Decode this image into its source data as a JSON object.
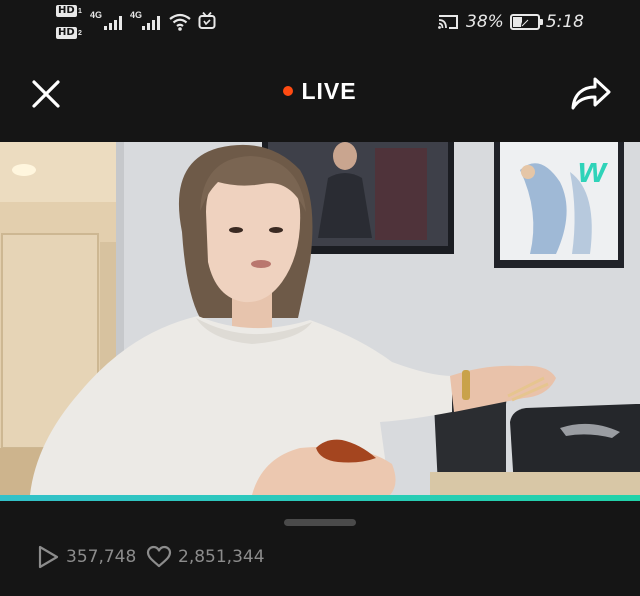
{
  "status_bar": {
    "hd1_label": "HD",
    "hd1_sub": "1",
    "hd2_label": "HD",
    "hd2_sub": "2",
    "net1_label": "4G",
    "net2_label": "4G",
    "battery_percent": "38%",
    "battery_level": 0.38,
    "time": "5:18",
    "icons": [
      "hd-icon",
      "signal-icon",
      "wifi-icon",
      "tv-icon",
      "cast-icon",
      "battery-icon",
      "leaf-icon"
    ]
  },
  "header": {
    "title": "LIVE",
    "live_dot_color": "#ff4b12",
    "close_icon": "close-icon",
    "share_icon": "share-icon"
  },
  "video": {
    "watermark": "w",
    "watermark_color": "#2fd3b9",
    "progress": 1.0,
    "progress_color": "#2ecfbf"
  },
  "stats": {
    "plays": "357,748",
    "likes": "2,851,344",
    "play_icon": "play-icon",
    "heart_icon": "heart-icon"
  }
}
